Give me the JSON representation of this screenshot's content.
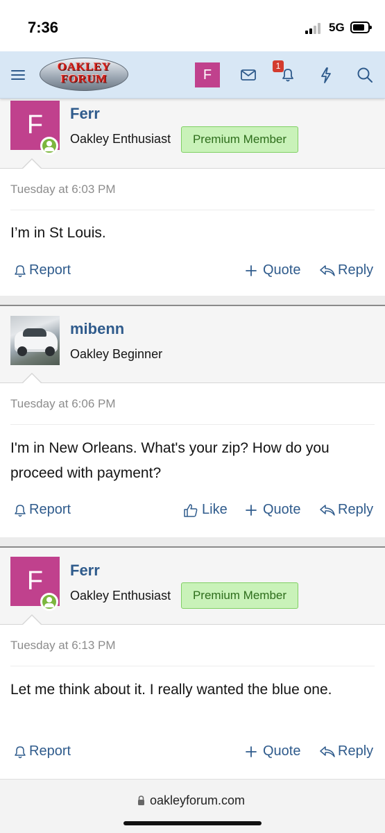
{
  "status_bar": {
    "time": "7:36",
    "network": "5G"
  },
  "navbar": {
    "logo_line1": "OAKLEY",
    "logo_line2": "FORUM",
    "user_initial": "F",
    "notification_count": "1"
  },
  "posts": [
    {
      "username": "Ferr",
      "avatar_letter": "F",
      "user_title": "Oakley Enthusiast",
      "badge": "Premium Member",
      "date": "Tuesday at 6:03 PM",
      "message": "I’m in St Louis.",
      "actions": {
        "report": "Report",
        "quote": "Quote",
        "reply": "Reply"
      }
    },
    {
      "username": "mibenn",
      "user_title": "Oakley Beginner",
      "date": "Tuesday at 6:06 PM",
      "message": "I'm in New Orleans. What's your zip? How do you proceed with payment?",
      "actions": {
        "report": "Report",
        "like": "Like",
        "quote": "Quote",
        "reply": "Reply"
      }
    },
    {
      "username": "Ferr",
      "avatar_letter": "F",
      "user_title": "Oakley Enthusiast",
      "badge": "Premium Member",
      "date": "Tuesday at 6:13 PM",
      "message": "Let me think about it. I really wanted the blue one.",
      "actions": {
        "report": "Report",
        "quote": "Quote",
        "reply": "Reply"
      }
    }
  ],
  "browser": {
    "url": "oakleyforum.com"
  },
  "colors": {
    "accent": "#2f5b8c",
    "avatar": "#c0418d",
    "badge_bg": "#c9f2b9",
    "navbar_bg": "#d8e7f5"
  }
}
